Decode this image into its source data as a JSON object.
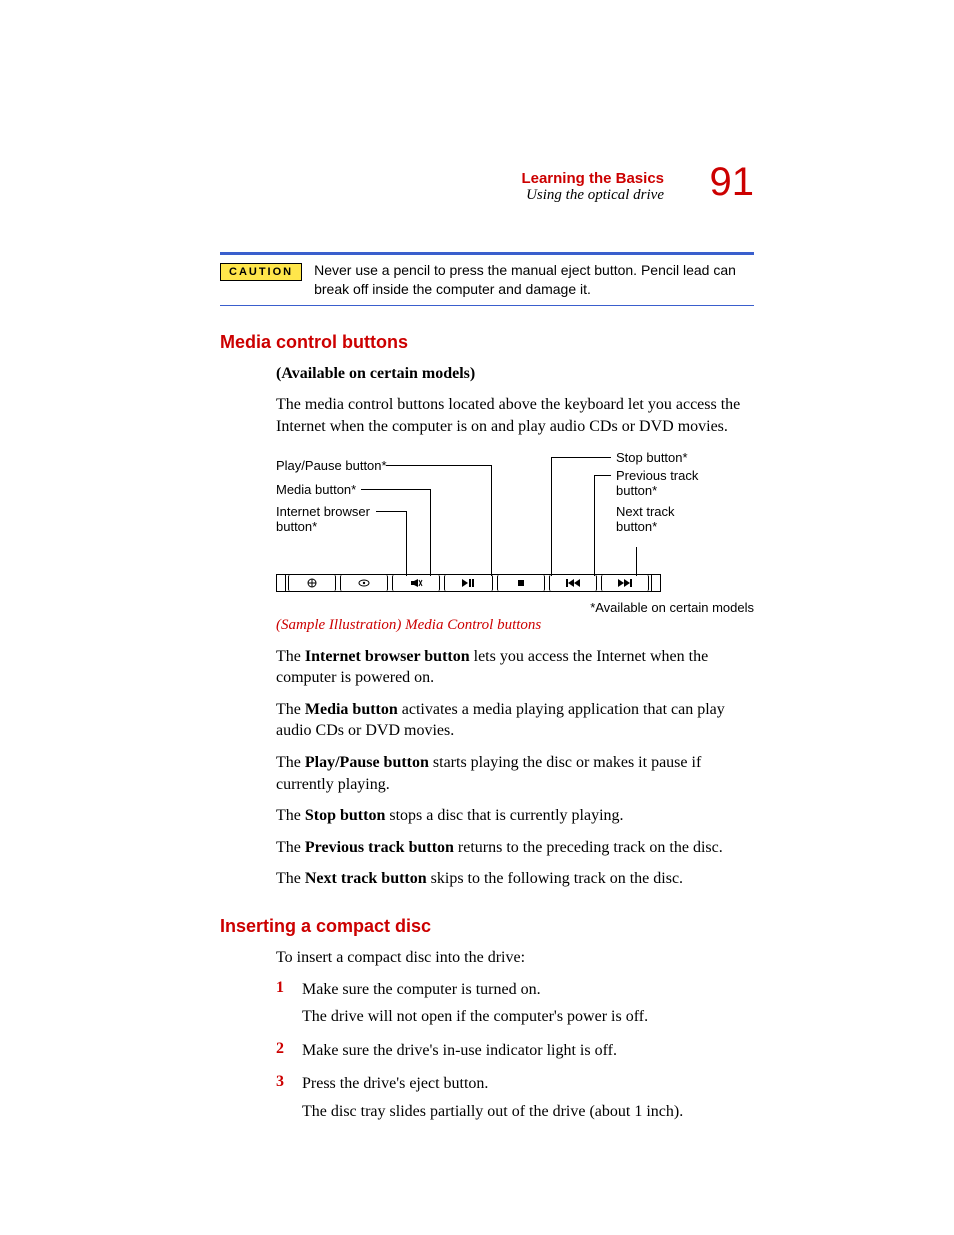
{
  "header": {
    "chapter": "Learning the Basics",
    "subtitle": "Using the optical drive",
    "page": "91"
  },
  "caution": {
    "badge": "CAUTION",
    "text": "Never use a pencil to press the manual eject button. Pencil lead can break off inside the computer and damage it."
  },
  "sections": {
    "media": {
      "heading": "Media control buttons",
      "availability": "(Available on certain models)",
      "intro": "The media control buttons located above the keyboard let you access the Internet when the computer is on and play audio CDs or DVD movies.",
      "labels": {
        "play_pause": "Play/Pause button*",
        "media": "Media button*",
        "internet_l1": "Internet browser",
        "internet_l2": "button*",
        "stop": "Stop button*",
        "prev_l1": "Previous track",
        "prev_l2": "button*",
        "next_l1": "Next track",
        "next_l2": "button*"
      },
      "footnote": "*Available on certain models",
      "caption": "(Sample Illustration) Media Control buttons",
      "paras": {
        "p1_a": "The ",
        "p1_b": "Internet browser button",
        "p1_c": " lets you access the Internet when the computer is powered on.",
        "p2_a": "The ",
        "p2_b": "Media button",
        "p2_c": " activates a media playing application that can play audio CDs or DVD movies.",
        "p3_a": "The ",
        "p3_b": "Play/Pause button",
        "p3_c": " starts playing the disc or makes it pause if currently playing.",
        "p4_a": "The ",
        "p4_b": "Stop button",
        "p4_c": " stops a disc that is currently playing.",
        "p5_a": "The ",
        "p5_b": "Previous track button",
        "p5_c": " returns to the preceding track on the disc.",
        "p6_a": "The ",
        "p6_b": "Next track button",
        "p6_c": " skips to the following track on the disc."
      }
    },
    "insert": {
      "heading": "Inserting a compact disc",
      "intro": "To insert a compact disc into the drive:",
      "steps": {
        "s1a": "Make sure the computer is turned on.",
        "s1b": "The drive will not open if the computer's power is off.",
        "s2": "Make sure the drive's in-use indicator light is off.",
        "s3a": "Press the drive's eject button.",
        "s3b": "The disc tray slides partially out of the drive (about 1 inch)."
      },
      "nums": {
        "n1": "1",
        "n2": "2",
        "n3": "3"
      }
    }
  }
}
